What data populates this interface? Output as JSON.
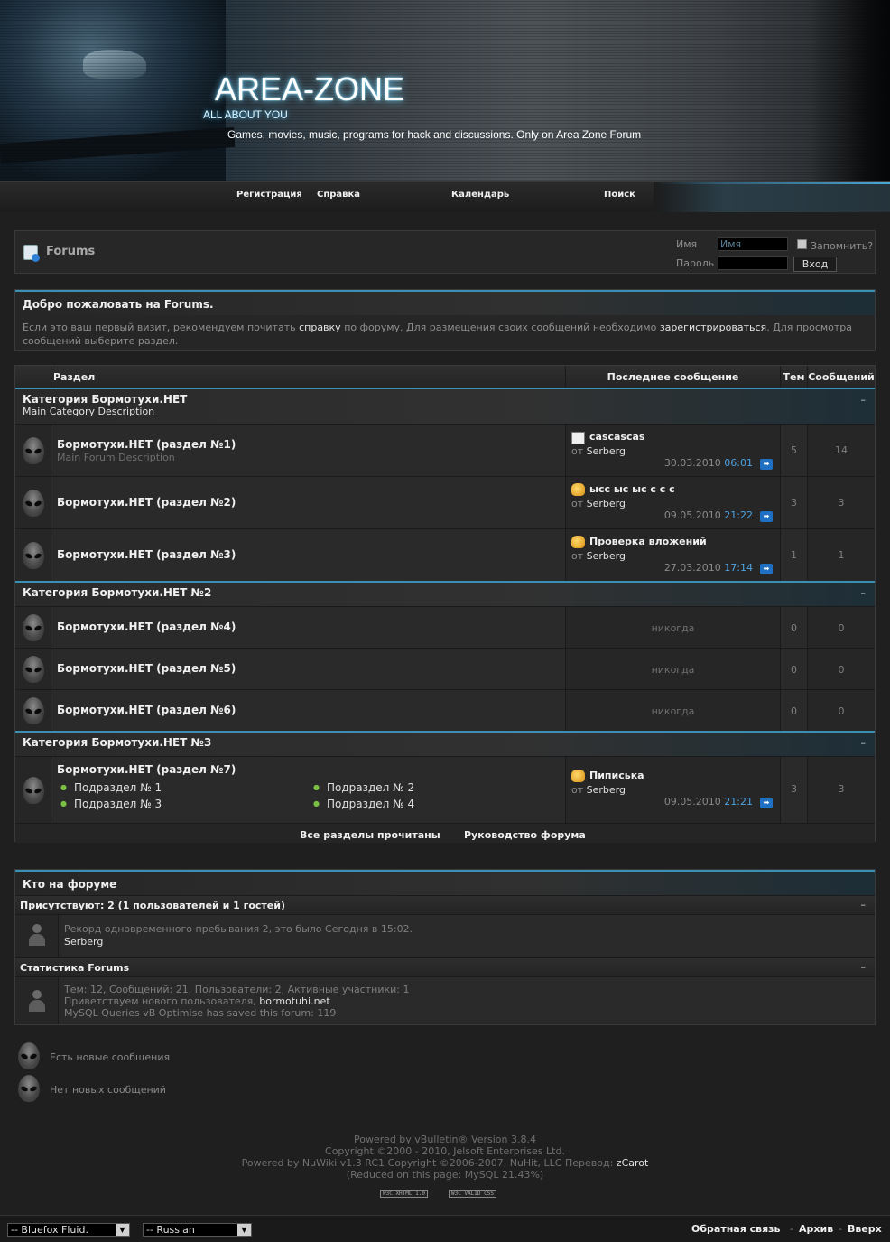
{
  "header": {
    "title": "AREA-ZONE",
    "tagline": "ALL ABOUT YOU",
    "slogan": "Games, movies, music, programs for hack and discussions. Only on Area Zone Forum"
  },
  "nav": {
    "register": "Регистрация",
    "help": "Справка",
    "calendar": "Календарь",
    "search": "Поиск"
  },
  "login": {
    "forums_label": "Forums",
    "username_label": "Имя",
    "username_value": "Имя",
    "password_label": "Пароль",
    "remember_label": "Запомнить?",
    "login_button": "Вход"
  },
  "welcome": {
    "title": "Добро пожаловать на Forums.",
    "text_1": "Если это ваш первый визит, рекомендуем почитать ",
    "link_help": "справку",
    "text_2": " по форуму. Для размещения своих сообщений необходимо ",
    "link_register": "зарегистрироваться",
    "text_3": ". Для просмотра сообщений выберите раздел."
  },
  "table": {
    "col_forum": "Раздел",
    "col_last": "Последнее сообщение",
    "col_threads": "Тем",
    "col_posts": "Сообщений",
    "collapse": "–",
    "categories": [
      {
        "title": "Категория Бормотухи.НЕТ",
        "desc": "Main Category Description",
        "forums": [
          {
            "title": "Бормотухи.НЕТ (раздел №1)",
            "desc": "Main Forum Description",
            "last_title": "cascascas",
            "by_prefix": "от",
            "last_by": "Serberg",
            "last_date": "30.03.2010",
            "last_time": "06:01",
            "threads": "5",
            "posts": "14",
            "icon": "doc-icon"
          },
          {
            "title": "Бормотухи.НЕТ (раздел №2)",
            "desc": "",
            "last_title": "ысс ыс ыс с с с",
            "by_prefix": "от",
            "last_by": "Serberg",
            "last_date": "09.05.2010",
            "last_time": "21:22",
            "threads": "3",
            "posts": "3",
            "icon": "thumbs-up-icon"
          },
          {
            "title": "Бормотухи.НЕТ (раздел №3)",
            "desc": "",
            "last_title": "Проверка вложений",
            "by_prefix": "от",
            "last_by": "Serberg",
            "last_date": "27.03.2010",
            "last_time": "17:14",
            "threads": "1",
            "posts": "1",
            "icon": "thumbs-up-icon"
          }
        ]
      },
      {
        "title": "Категория Бормотухи.НЕТ №2",
        "desc": "",
        "forums": [
          {
            "title": "Бормотухи.НЕТ (раздел №4)",
            "never": "никогда",
            "threads": "0",
            "posts": "0"
          },
          {
            "title": "Бормотухи.НЕТ (раздел №5)",
            "never": "никогда",
            "threads": "0",
            "posts": "0"
          },
          {
            "title": "Бормотухи.НЕТ (раздел №6)",
            "never": "никогда",
            "threads": "0",
            "posts": "0"
          }
        ]
      },
      {
        "title": "Категория Бормотухи.НЕТ №3",
        "desc": "",
        "forums": [
          {
            "title": "Бормотухи.НЕТ (раздел №7)",
            "subforums": [
              "Подраздел № 1",
              "Подраздел № 2",
              "Подраздел № 3",
              "Подраздел № 4"
            ],
            "last_title": "Пиписька",
            "by_prefix": "от",
            "last_by": "Serberg",
            "last_date": "09.05.2010",
            "last_time": "21:21",
            "threads": "3",
            "posts": "3",
            "icon": "thumbs-up-icon"
          }
        ]
      }
    ],
    "link_mark_read": "Все разделы прочитаны",
    "link_leaders": "Руководство форума"
  },
  "online": {
    "title": "Кто на форуме",
    "present_title": "Присутствуют: 2 (1 пользователей и 1 гостей)",
    "record_text": "Рекорд одновременного пребывания 2, это было Сегодня в 15:02.",
    "online_user": "Serberg",
    "stats_title": "Статистика Forums",
    "stats_line": "Тем: 12, Сообщений: 21, Пользователи: 2, Активные участники: 1",
    "welcome_new": "Приветствуем нового пользователя, ",
    "new_user": "bormotuhi.net",
    "mysql_line": "MySQL Queries vB Optimise has saved this forum: 119",
    "collapse": "–"
  },
  "legend": {
    "new_posts": "Есть новые сообщения",
    "no_new_posts": "Нет новых сообщений"
  },
  "footer": {
    "line1": "Powered by vBulletin® Version 3.8.4",
    "line2": "Copyright ©2000 - 2010, Jelsoft Enterprises Ltd.",
    "line3_prefix": "Powered by NuWiki v1.3 RC1 Copyright ©2006-2007, NuHit, LLC Перевод: ",
    "line3_link": "zCarot",
    "line4": "(Reduced on this page: MySQL 21.43%)",
    "badge_xhtml": "W3C XHTML 1.0",
    "badge_css": "W3C VALID CSS"
  },
  "bottom": {
    "style_select": "-- Bluefox Fluid.",
    "lang_select": "-- Russian",
    "contact": "Обратная связь",
    "archive": "Архив",
    "top": "Вверх",
    "sep": "-"
  }
}
